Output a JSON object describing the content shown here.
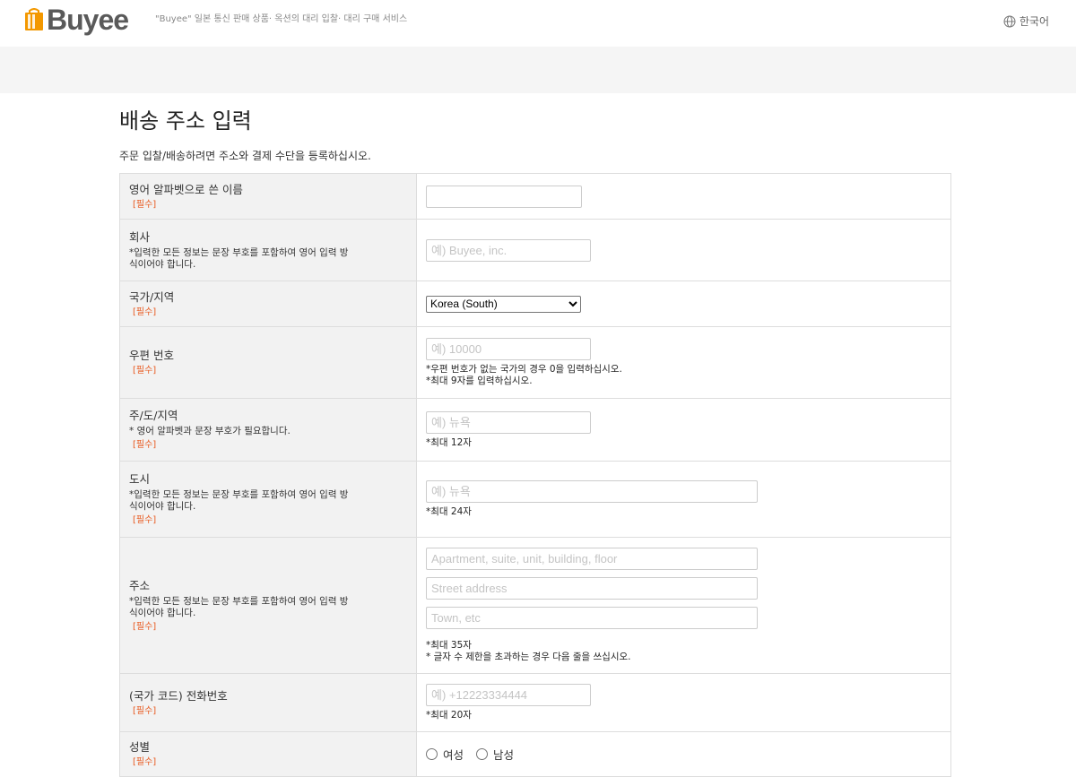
{
  "header": {
    "logo_text": "Buyee",
    "tagline": "\"Buyee\" 일본 통신 판매 상품· 옥션의 대리 입찰· 대리 구매 서비스",
    "language": "한국어",
    "brand_color": "#f39800"
  },
  "page": {
    "title": "배송 주소 입력",
    "intro": "주문 입찰/배송하려면 주소와 결제 수단을 등록하십시오."
  },
  "form": {
    "required_tag": "[필수]",
    "name": {
      "label": "영어 알파벳으로 쓴 이름",
      "value": ""
    },
    "company": {
      "label": "회사",
      "note_line1": "*입력한 모든 정보는 문장 부호를 포함하여 영어 입력 방",
      "note_line2": "식이어야 합니다.",
      "placeholder": "예) Buyee, inc."
    },
    "country": {
      "label": "국가/지역",
      "selected": "Korea (South)"
    },
    "postal": {
      "label": "우편 번호",
      "placeholder": "예) 10000",
      "hint1": "*우편 번호가 없는 국가의 경우 0을 입력하십시오.",
      "hint2": "*최대 9자를 입력하십시오."
    },
    "state": {
      "label": "주/도/지역",
      "note": "* 영어 알파벳과 문장 부호가 필요합니다.",
      "placeholder": "예) 뉴욕",
      "hint": "*최대 12자"
    },
    "city": {
      "label": "도시",
      "note_line1": "*입력한 모든 정보는 문장 부호를 포함하여 영어 입력 방",
      "note_line2": "식이어야 합니다.",
      "placeholder": "예) 뉴욕",
      "hint": "*최대 24자"
    },
    "address": {
      "label": "주소",
      "note_line1": "*입력한 모든 정보는 문장 부호를 포함하여 영어 입력 방",
      "note_line2": "식이어야 합니다.",
      "placeholder1": "Apartment, suite, unit, building, floor",
      "placeholder2": "Street address",
      "placeholder3": "Town, etc",
      "hint1": "*최대 35자",
      "hint2": "* 글자 수 제한을 초과하는 경우 다음 줄을 쓰십시오."
    },
    "phone": {
      "label": "(국가 코드) 전화번호",
      "placeholder": "예) +12223334444",
      "hint": "*최대 20자"
    },
    "gender": {
      "label": "성별",
      "female": "여성",
      "male": "남성"
    }
  }
}
